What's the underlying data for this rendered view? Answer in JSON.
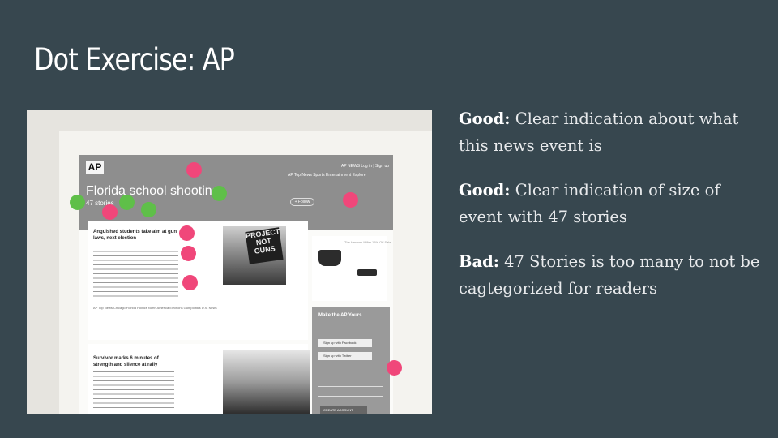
{
  "slide": {
    "title": "Dot Exercise: AP"
  },
  "photo": {
    "site_header": {
      "logo": "AP",
      "top_links": "AP NEWS  Log in | Sign up",
      "nav": "AP Top News   Sports   Entertainment   Explore",
      "topic_title": "Florida school shooting",
      "story_count": "47 stories",
      "follow_button": "+ Follow"
    },
    "story_1": {
      "headline": "Anguished students take aim at gun laws, next election",
      "tags": "AP Top News  Chicago  Florida  Politics  North America  Elections  Gun politics  U.S. News",
      "sign_text": "PROJECT NOT GUNS"
    },
    "story_2": {
      "headline": "Survivor marks 6 minutes of strength and silence at rally"
    },
    "ad": {
      "text": "The Herman Miller 15% Off Sale"
    },
    "promo": {
      "title": "Make the AP Yours",
      "facebook_button": "Sign up with Facebook",
      "twitter_button": "Sign up with Twitter",
      "create_button": "CREATE ACCOUNT"
    },
    "dot_colors": {
      "bad": "#f0477a",
      "good": "#5fbf49"
    }
  },
  "notes": [
    {
      "label": "Good:",
      "text": " Clear indication about what this news event is"
    },
    {
      "label": "Good:",
      "text": " Clear indication of size of event with 47 stories"
    },
    {
      "label": "Bad:",
      "text": " 47 Stories is too many to not be cagtegorized for readers"
    }
  ]
}
